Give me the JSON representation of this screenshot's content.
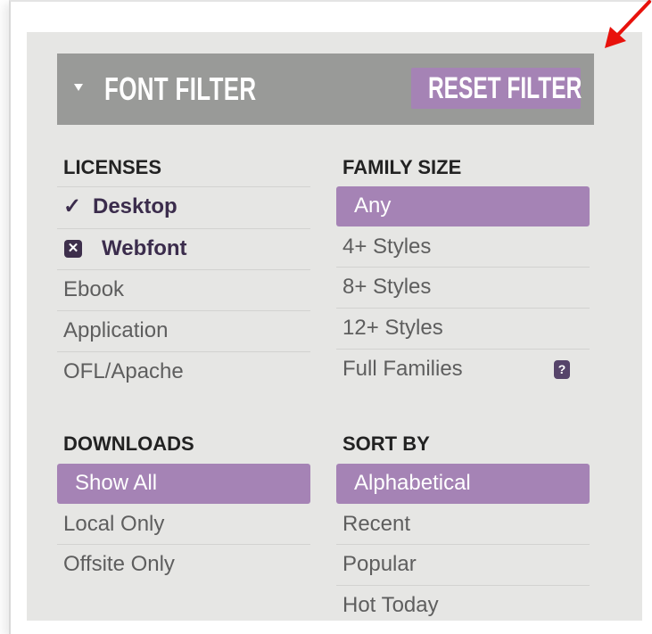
{
  "filter": {
    "title": "FONT FILTER",
    "reset_label": "RESET FILTER"
  },
  "licenses": {
    "heading": "LICENSES",
    "items": [
      {
        "label": "Desktop",
        "prefix": "✓",
        "state": "checked"
      },
      {
        "label": "Webfont",
        "prefix": "✕",
        "state": "excluded"
      },
      {
        "label": "Ebook"
      },
      {
        "label": "Application"
      },
      {
        "label": "OFL/Apache"
      }
    ]
  },
  "family_size": {
    "heading": "FAMILY SIZE",
    "items": [
      {
        "label": "Any",
        "selected": true
      },
      {
        "label": "4+ Styles"
      },
      {
        "label": "8+ Styles"
      },
      {
        "label": "12+ Styles"
      },
      {
        "label": "Full Families",
        "help": "?"
      }
    ]
  },
  "downloads": {
    "heading": "DOWNLOADS",
    "items": [
      {
        "label": "Show All",
        "selected": true
      },
      {
        "label": "Local Only"
      },
      {
        "label": "Offsite Only"
      }
    ]
  },
  "sort_by": {
    "heading": "SORT BY",
    "items": [
      {
        "label": "Alphabetical",
        "selected": true
      },
      {
        "label": "Recent"
      },
      {
        "label": "Popular"
      },
      {
        "label": "Hot Today"
      }
    ]
  },
  "colors": {
    "accent": "#a583b5",
    "header_bg": "#999a98",
    "panel_bg": "#e6e6e4",
    "annotation_arrow": "#e8120c"
  }
}
